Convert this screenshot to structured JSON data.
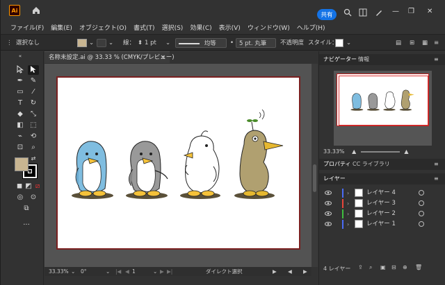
{
  "app": {
    "logo": "Ai",
    "share_label": "共有"
  },
  "menu": [
    "ファイル(F)",
    "編集(E)",
    "オブジェクト(O)",
    "書式(T)",
    "選択(S)",
    "効果(C)",
    "表示(V)",
    "ウィンドウ(W)",
    "ヘルプ(H)"
  ],
  "control": {
    "selection": "選択なし",
    "stroke_label": "線：",
    "stroke_width": "1 pt",
    "stroke_profile": "均等",
    "brush": "5 pt. 丸筆",
    "opacity_label": "不透明度",
    "style_label": "スタイル："
  },
  "document": {
    "tab_title": "名称未設定.ai @ 33.33 % (CMYK/プレビュー)",
    "close": "×"
  },
  "status": {
    "zoom": "33.33%",
    "rotation": "0°",
    "artboard": "1",
    "tool": "ダイレクト選択"
  },
  "panels": {
    "navigator_tab": "ナビゲーター",
    "info_tab": "情報",
    "zoom_value": "33.33%",
    "properties_tab": "プロパティ",
    "libraries_tab": "CC ライブラリ",
    "layers_tab": "レイヤー",
    "layer_count": "4 レイヤー"
  },
  "layers": [
    {
      "name": "レイヤー 4",
      "color": "#4a6cf7"
    },
    {
      "name": "レイヤー 3",
      "color": "#e8463a"
    },
    {
      "name": "レイヤー 2",
      "color": "#3fbf3f"
    },
    {
      "name": "レイヤー 1",
      "color": "#4a6cf7"
    }
  ],
  "colors": {
    "fill_swatch": "#c8b591",
    "accent": "#1473e6"
  }
}
